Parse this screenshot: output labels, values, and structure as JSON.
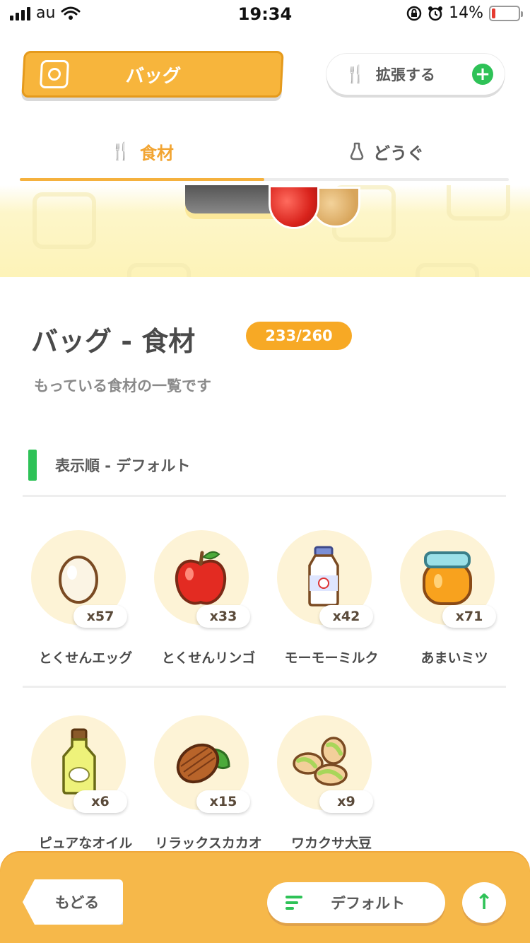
{
  "status_bar": {
    "carrier": "au",
    "time": "19:34",
    "battery_percent": "14%"
  },
  "header": {
    "bag_title": "バッグ",
    "expand_label": "拡張する"
  },
  "tabs": [
    {
      "label": "食材",
      "active": true
    },
    {
      "label": "どうぐ",
      "active": false
    }
  ],
  "section": {
    "title": "バッグ - 食材",
    "capacity": "233/260",
    "subtitle": "もっている食材の一覧です",
    "sort_label": "表示順 - デフォルト"
  },
  "items": [
    {
      "name": "とくせんエッグ",
      "count": "x57",
      "icon": "egg-icon"
    },
    {
      "name": "とくせんリンゴ",
      "count": "x33",
      "icon": "apple-icon"
    },
    {
      "name": "モーモーミルク",
      "count": "x42",
      "icon": "milk-icon"
    },
    {
      "name": "あまいミツ",
      "count": "x71",
      "icon": "honey-icon"
    },
    {
      "name": "ピュアなオイル",
      "count": "x6",
      "icon": "oil-icon"
    },
    {
      "name": "リラックスカカオ",
      "count": "x15",
      "icon": "cacao-icon"
    },
    {
      "name": "ワカクサ大豆",
      "count": "x9",
      "icon": "soybean-icon"
    }
  ],
  "bottom_bar": {
    "back_label": "もどる",
    "sort_button_label": "デフォルト"
  },
  "colors": {
    "accent_orange": "#f7b53c",
    "accent_green": "#2ec257",
    "battery_red": "#e53b30"
  }
}
